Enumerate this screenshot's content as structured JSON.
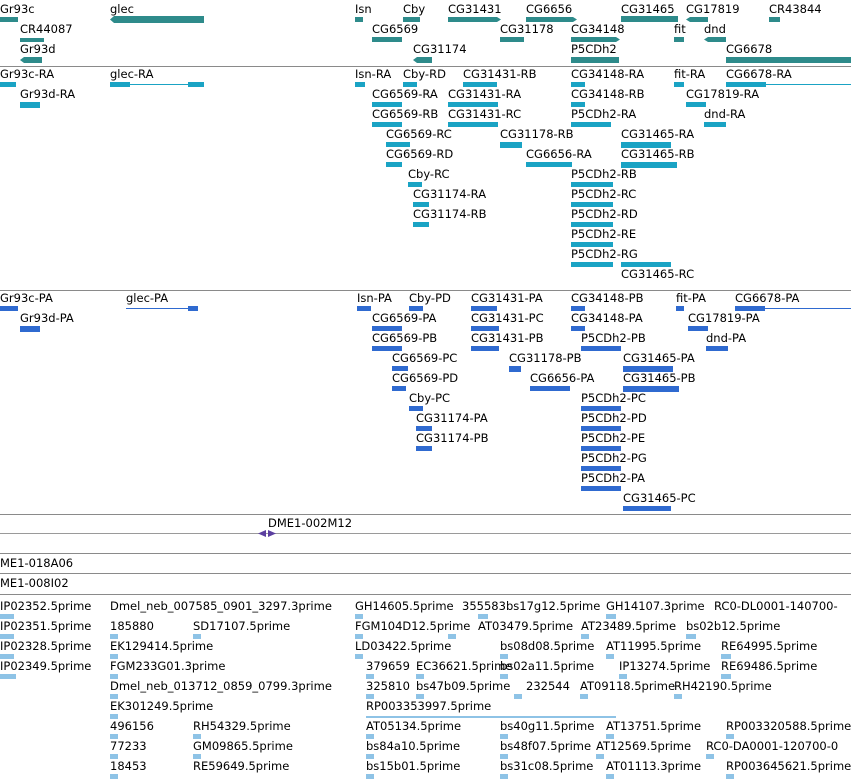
{
  "tracks": {
    "genes": [
      {
        "name": "Gr93c"
      },
      {
        "name": "glec"
      },
      {
        "name": "Isn"
      },
      {
        "name": "Cby"
      },
      {
        "name": "CG31431"
      },
      {
        "name": "CG6656"
      },
      {
        "name": "CG31465"
      },
      {
        "name": "CG17819"
      },
      {
        "name": "CR43844"
      },
      {
        "name": "CR44087"
      },
      {
        "name": "Gr93d"
      },
      {
        "name": "CG6569"
      },
      {
        "name": "CG31178"
      },
      {
        "name": "CG34148"
      },
      {
        "name": "fit"
      },
      {
        "name": "dnd"
      },
      {
        "name": "CG31174"
      },
      {
        "name": "P5CDh2"
      },
      {
        "name": "CG6678"
      }
    ],
    "transcripts": [
      {
        "name": "Gr93c-RA"
      },
      {
        "name": "glec-RA"
      },
      {
        "name": "Isn-RA"
      },
      {
        "name": "Cby-RD"
      },
      {
        "name": "CG31431-RB"
      },
      {
        "name": "CG34148-RA"
      },
      {
        "name": "fit-RA"
      },
      {
        "name": "CG6678-RA"
      },
      {
        "name": "Gr93d-RA"
      },
      {
        "name": "CG6569-RA"
      },
      {
        "name": "CG31431-RA"
      },
      {
        "name": "CG34148-RB"
      },
      {
        "name": "CG17819-RA"
      },
      {
        "name": "CG6569-RB"
      },
      {
        "name": "CG31431-RC"
      },
      {
        "name": "P5CDh2-RA"
      },
      {
        "name": "dnd-RA"
      },
      {
        "name": "CG6569-RC"
      },
      {
        "name": "CG31178-RB"
      },
      {
        "name": "CG31465-RA"
      },
      {
        "name": "CG6569-RD"
      },
      {
        "name": "CG6656-RA"
      },
      {
        "name": "CG31465-RB"
      },
      {
        "name": "Cby-RC"
      },
      {
        "name": "P5CDh2-RB"
      },
      {
        "name": "CG31174-RA"
      },
      {
        "name": "P5CDh2-RC"
      },
      {
        "name": "CG31174-RB"
      },
      {
        "name": "P5CDh2-RD"
      },
      {
        "name": "P5CDh2-RE"
      },
      {
        "name": "P5CDh2-RG"
      },
      {
        "name": "CG31465-RC"
      }
    ],
    "proteins": [
      {
        "name": "Gr93c-PA"
      },
      {
        "name": "glec-PA"
      },
      {
        "name": "Isn-PA"
      },
      {
        "name": "Cby-PD"
      },
      {
        "name": "CG31431-PA"
      },
      {
        "name": "CG34148-PB"
      },
      {
        "name": "fit-PA"
      },
      {
        "name": "CG6678-PA"
      },
      {
        "name": "Gr93d-PA"
      },
      {
        "name": "CG6569-PA"
      },
      {
        "name": "CG31431-PC"
      },
      {
        "name": "CG34148-PA"
      },
      {
        "name": "CG17819-PA"
      },
      {
        "name": "CG6569-PB"
      },
      {
        "name": "CG31431-PB"
      },
      {
        "name": "P5CDh2-PB"
      },
      {
        "name": "dnd-PA"
      },
      {
        "name": "CG6569-PC"
      },
      {
        "name": "CG31178-PB"
      },
      {
        "name": "CG31465-PA"
      },
      {
        "name": "CG6569-PD"
      },
      {
        "name": "CG6656-PA"
      },
      {
        "name": "CG31465-PB"
      },
      {
        "name": "Cby-PC"
      },
      {
        "name": "P5CDh2-PC"
      },
      {
        "name": "CG31174-PA"
      },
      {
        "name": "P5CDh2-PD"
      },
      {
        "name": "CG31174-PB"
      },
      {
        "name": "P5CDh2-PE"
      },
      {
        "name": "P5CDh2-PG"
      },
      {
        "name": "P5CDh2-PA"
      },
      {
        "name": "CG31465-PC"
      }
    ],
    "clone_tracks": [
      {
        "name": "DME1-002M12"
      },
      {
        "name": "ME1-018A06"
      },
      {
        "name": "ME1-008I02"
      }
    ],
    "ests": [
      {
        "name": "IP02352.5prime"
      },
      {
        "name": "Dmel_neb_007585_0901_3297.3prime"
      },
      {
        "name": "GH14605.5prime"
      },
      {
        "name": "355583"
      },
      {
        "name": "bs17g12.5prime"
      },
      {
        "name": "GH14107.3prime"
      },
      {
        "name": "RC0-DL0001-140700-"
      },
      {
        "name": "IP02351.5prime"
      },
      {
        "name": "185880"
      },
      {
        "name": "SD17107.5prime"
      },
      {
        "name": "FGM104D12.5prime"
      },
      {
        "name": "AT03479.5prime"
      },
      {
        "name": "AT23489.5prime"
      },
      {
        "name": "bs02b12.5prime"
      },
      {
        "name": "IP02328.5prime"
      },
      {
        "name": "EK129414.5prime"
      },
      {
        "name": "LD03422.5prime"
      },
      {
        "name": "bs08d08.5prime"
      },
      {
        "name": "AT11995.5prime"
      },
      {
        "name": "RE64995.5prime"
      },
      {
        "name": "IP02349.5prime"
      },
      {
        "name": "FGM233G01.3prime"
      },
      {
        "name": "379659"
      },
      {
        "name": "EC36621.5prime"
      },
      {
        "name": "bs02a11.5prime"
      },
      {
        "name": "IP13274.5prime"
      },
      {
        "name": "RE69486.5prime"
      },
      {
        "name": "Dmel_neb_013712_0859_0799.3prime"
      },
      {
        "name": "325810"
      },
      {
        "name": "bs47b09.5prime"
      },
      {
        "name": "232544"
      },
      {
        "name": "AT09118.5prime"
      },
      {
        "name": "RH42190.5prime"
      },
      {
        "name": "EK301249.5prime"
      },
      {
        "name": "RP003353997.5prime"
      },
      {
        "name": "496156"
      },
      {
        "name": "RH54329.5prime"
      },
      {
        "name": "AT05134.5prime"
      },
      {
        "name": "bs40g11.5prime"
      },
      {
        "name": "AT13751.5prime"
      },
      {
        "name": "RP003320588.5prime"
      },
      {
        "name": "77233"
      },
      {
        "name": "GM09865.5prime"
      },
      {
        "name": "bs84a10.5prime"
      },
      {
        "name": "bs48f07.5prime"
      },
      {
        "name": "AT12569.5prime"
      },
      {
        "name": "RC0-DA0001-120700-0"
      },
      {
        "name": "18453"
      },
      {
        "name": "RE59649.5prime"
      },
      {
        "name": "bs15b01.5prime"
      },
      {
        "name": "bs31c08.5prime"
      },
      {
        "name": "AT01113.3prime"
      },
      {
        "name": "RP003645621.5prime"
      }
    ]
  },
  "colors": {
    "gene": "#2e8b8b",
    "transcript": "#1aa3c4",
    "protein": "#2f6ad0",
    "clone": "#5b3fa0",
    "est": "#8ec3e6",
    "separator": "#8a8a8a"
  }
}
